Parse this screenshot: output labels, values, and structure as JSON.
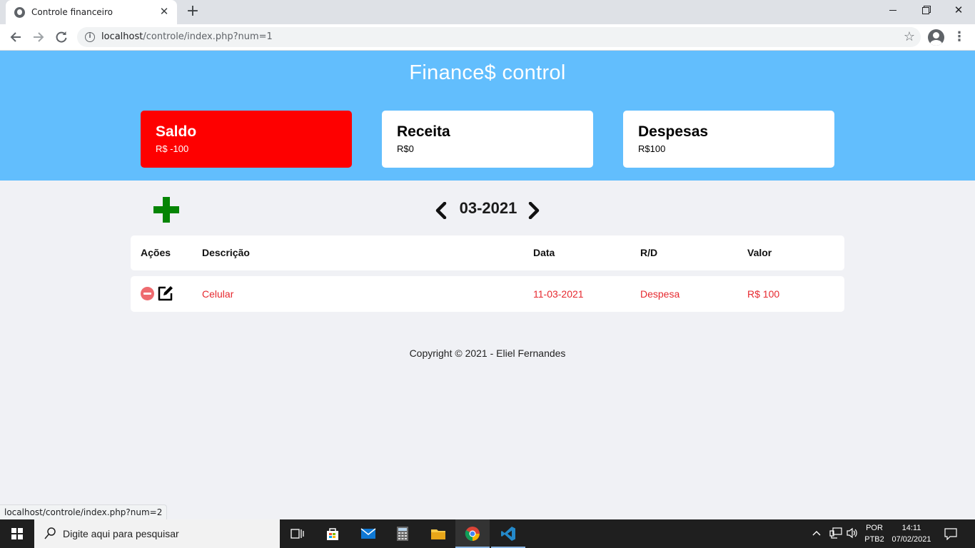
{
  "browser": {
    "tab_title": "Controle financeiro",
    "url_host": "localhost",
    "url_path": "/controle/index.php?num=1",
    "status_url": "localhost/controle/index.php?num=2"
  },
  "app": {
    "title": "Finance$ control",
    "cards": {
      "saldo": {
        "label": "Saldo",
        "value": "R$ -100",
        "color": "#fe0000"
      },
      "receita": {
        "label": "Receita",
        "value": "R$0"
      },
      "despesas": {
        "label": "Despesas",
        "value": "R$100"
      }
    },
    "header_color": "#62befd",
    "month": "03-2021",
    "table": {
      "headers": {
        "acoes": "Ações",
        "descricao": "Descrição",
        "data": "Data",
        "rd": "R/D",
        "valor": "Valor"
      },
      "rows": [
        {
          "descricao": "Celular",
          "data": "11-03-2021",
          "rd": "Despesa",
          "valor": "R$ 100",
          "text_color": "#e6292f"
        }
      ]
    },
    "footer": "Copyright © 2021 - Eliel Fernandes"
  },
  "taskbar": {
    "search_placeholder": "Digite aqui para pesquisar",
    "lang_top": "POR",
    "lang_bottom": "PTB2",
    "time": "14:11",
    "date": "07/02/2021"
  }
}
